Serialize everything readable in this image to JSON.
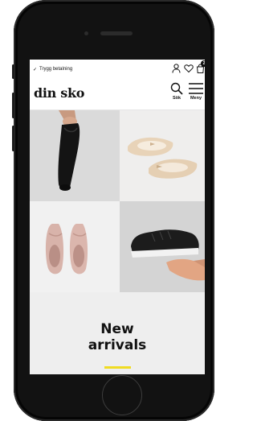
{
  "topbar": {
    "secure_text": "Trygg betalning",
    "check_icon": "check-icon",
    "account_icon": "account-icon",
    "wishlist_icon": "heart-icon",
    "cart_icon": "cart-icon",
    "cart_count": "2"
  },
  "header": {
    "logo_text": "din sko",
    "search_label": "Sök",
    "menu_label": "Meny",
    "search_icon": "search-icon",
    "menu_icon": "hamburger-icon"
  },
  "products": [
    {
      "name": "black loafer held in hand",
      "color": "#161616"
    },
    {
      "name": "beige ballerina flats",
      "color": "#e7d3bb"
    },
    {
      "name": "pink suede loafers",
      "color": "#d9b5ad"
    },
    {
      "name": "black leather sneaker on hand",
      "color": "#1c1c1c"
    }
  ],
  "banner": {
    "title_line1": "New",
    "title_line2": "arrivals",
    "accent_color": "#f0dc22"
  }
}
